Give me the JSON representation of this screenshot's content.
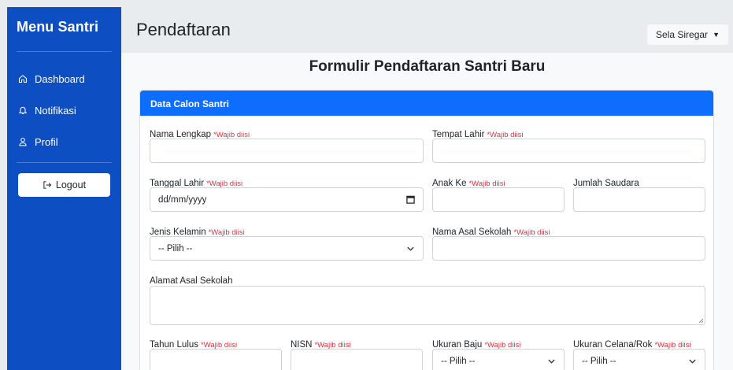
{
  "sidebar": {
    "brand": "Menu Santri",
    "items": [
      {
        "label": "Dashboard",
        "icon": "home-icon"
      },
      {
        "label": "Notifikasi",
        "icon": "bell-icon"
      },
      {
        "label": "Profil",
        "icon": "user-icon"
      }
    ],
    "logout_label": "Logout"
  },
  "header": {
    "title": "Pendaftaran",
    "user_name": "Sela Siregar"
  },
  "main": {
    "form_title": "Formulir Pendaftaran Santri Baru",
    "card_title": "Data Calon Santri",
    "required_note": "*Wajib diisi",
    "fields": {
      "nama_lengkap": {
        "label": "Nama Lengkap",
        "value": ""
      },
      "tempat_lahir": {
        "label": "Tempat Lahir",
        "value": ""
      },
      "tanggal_lahir": {
        "label": "Tanggal Lahir",
        "placeholder": "dd/mm/yyyy"
      },
      "anak_ke": {
        "label": "Anak Ke",
        "value": ""
      },
      "jumlah_saudara": {
        "label": "Jumlah Saudara",
        "value": ""
      },
      "jenis_kelamin": {
        "label": "Jenis Kelamin",
        "selected": "-- Pilih --"
      },
      "nama_asal_sekolah": {
        "label": "Nama Asal Sekolah",
        "value": ""
      },
      "alamat_asal_sekolah": {
        "label": "Alamat Asal Sekolah",
        "value": ""
      },
      "tahun_lulus": {
        "label": "Tahun Lulus",
        "value": ""
      },
      "nisn": {
        "label": "NISN",
        "value": ""
      },
      "ukuran_baju": {
        "label": "Ukuran Baju",
        "selected": "-- Pilih --"
      },
      "ukuran_celana": {
        "label": "Ukuran Celana/Rok",
        "selected": "-- Pilih --"
      }
    }
  },
  "colors": {
    "sidebar_bg": "#0d4fc3",
    "card_header_bg": "#0d6efd",
    "required_red": "#dc3545"
  }
}
